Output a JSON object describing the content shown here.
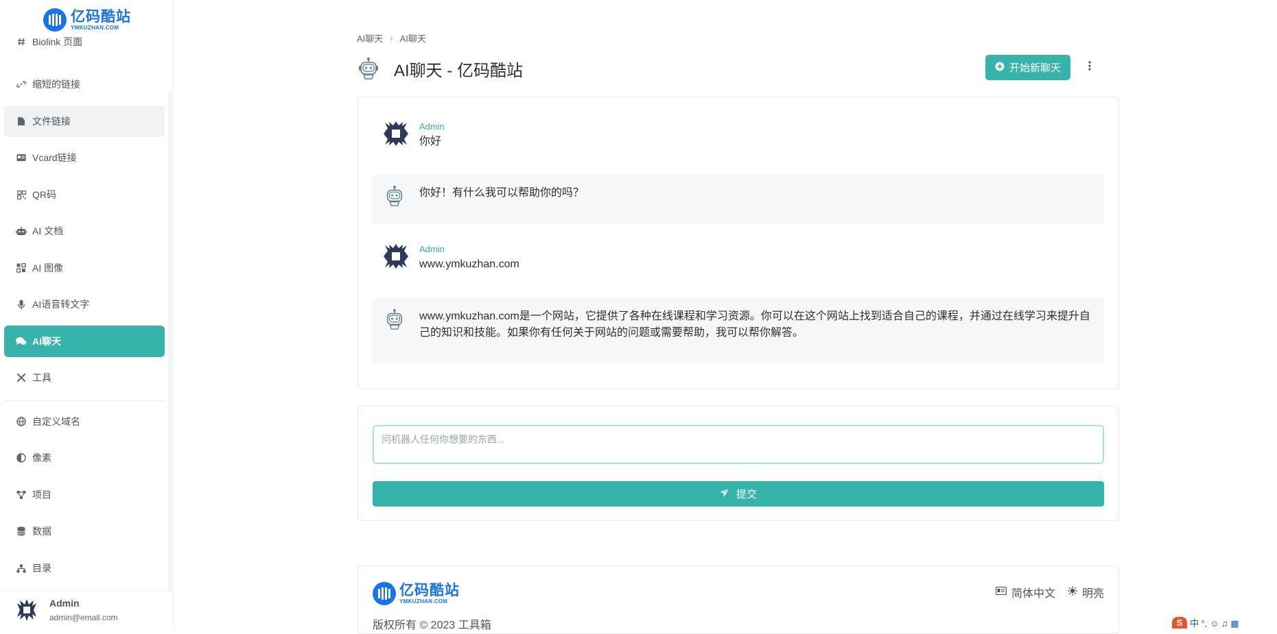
{
  "brand": {
    "name_cn": "亿码酷站",
    "name_en": "YMKUZHAN.COM",
    "color": "#1a73e8"
  },
  "accent_color": "#36b3aa",
  "sidebar": {
    "items": [
      {
        "label": "Biolink 页面",
        "icon": "hash-icon"
      },
      {
        "label": "缩短的链接",
        "icon": "link-icon"
      },
      {
        "label": "文件链接",
        "icon": "file-icon"
      },
      {
        "label": "Vcard链接",
        "icon": "id-card-icon"
      },
      {
        "label": "QR码",
        "icon": "qr-code-icon"
      },
      {
        "label": "AI 文档",
        "icon": "robot-icon"
      },
      {
        "label": "AI 图像",
        "icon": "image-grid-icon"
      },
      {
        "label": "AI语音转文字",
        "icon": "microphone-icon"
      },
      {
        "label": "AI聊天",
        "icon": "chat-bubbles-icon"
      },
      {
        "label": "工具",
        "icon": "tools-icon"
      },
      {
        "label": "自定义域名",
        "icon": "globe-icon"
      },
      {
        "label": "像素",
        "icon": "half-circle-icon"
      },
      {
        "label": "项目",
        "icon": "nodes-icon"
      },
      {
        "label": "数据",
        "icon": "database-icon"
      },
      {
        "label": "目录",
        "icon": "sitemap-icon"
      }
    ],
    "user": {
      "name": "Admin",
      "email": "admin@email.com"
    }
  },
  "breadcrumb": {
    "items": [
      "AI聊天",
      "AI聊天"
    ],
    "separator": "›"
  },
  "header": {
    "title": "AI聊天 - 亿码酷站",
    "new_chat_label": "开始新聊天"
  },
  "messages": [
    {
      "role": "user",
      "author": "Admin",
      "text": "你好"
    },
    {
      "role": "bot",
      "text": "你好！有什么我可以帮助你的吗？"
    },
    {
      "role": "user",
      "author": "Admin",
      "text": "www.ymkuzhan.com"
    },
    {
      "role": "bot",
      "text": "www.ymkuzhan.com是一个网站，它提供了各种在线课程和学习资源。你可以在这个网站上找到适合自己的课程，并通过在线学习来提升自己的知识和技能。如果你有任何关于网站的问题或需要帮助，我可以帮你解答。"
    }
  ],
  "composer": {
    "placeholder": "问机器人任何你想要的东西...",
    "value": "",
    "submit_label": "提交"
  },
  "footer": {
    "copyright": "版权所有 © 2023 工具箱",
    "language_label": "简体中文",
    "theme_label": "明亮"
  },
  "ime": {
    "badge": "S",
    "text": "中 °, ☺ ♫ ▦"
  }
}
